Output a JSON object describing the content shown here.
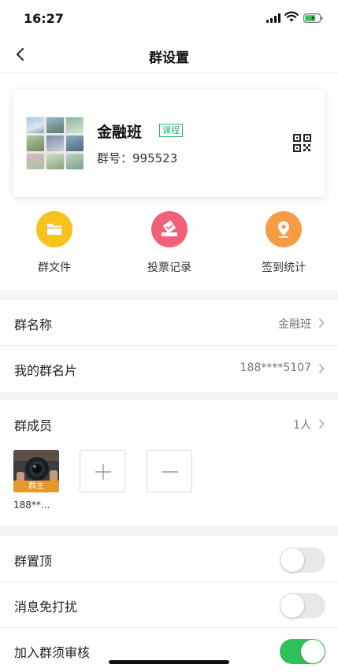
{
  "status_bar": {
    "time": "16:27"
  },
  "nav": {
    "title": "群设置",
    "back_icon": "chevron-left-icon"
  },
  "group": {
    "name": "金融班",
    "tag": "课程",
    "number": "群号：995523",
    "qr_icon": "qr-code-icon"
  },
  "actions": [
    {
      "label": "群文件",
      "icon": "folder-icon",
      "color": "#f7c21c"
    },
    {
      "label": "投票记录",
      "icon": "vote-box-icon",
      "color": "#f0607a"
    },
    {
      "label": "签到统计",
      "icon": "location-pin-icon",
      "color": "#f59c45"
    }
  ],
  "info_rows": [
    {
      "label": "群名称",
      "value": "金融班"
    },
    {
      "label": "我的群名片",
      "value": "188****5107"
    }
  ],
  "members": {
    "label": "群成员",
    "count": "1人",
    "owner_badge": "群主",
    "owner_nick": "188**...",
    "add_icon": "plus-icon",
    "remove_icon": "minus-icon"
  },
  "toggles": [
    {
      "label": "群置顶",
      "on": false
    },
    {
      "label": "消息免打扰",
      "on": false
    },
    {
      "label": "加入群须审核",
      "on": true
    }
  ],
  "colors": {
    "accent_green": "#30c25a",
    "tag_green": "#2bb36b",
    "badge_orange": "#e9962b"
  }
}
